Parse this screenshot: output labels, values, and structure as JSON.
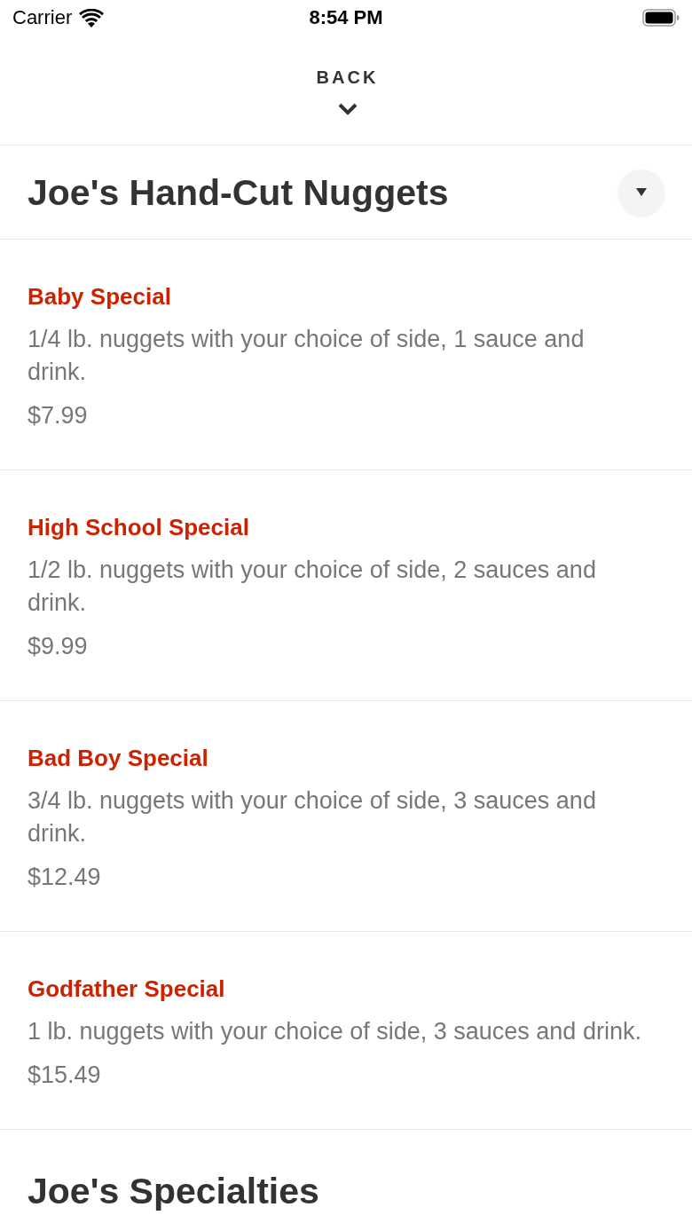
{
  "status_bar": {
    "carrier": "Carrier",
    "time": "8:54 PM"
  },
  "nav": {
    "back_label": "BACK"
  },
  "sections": [
    {
      "title": "Joe's Hand-Cut Nuggets",
      "dropdown": true,
      "items": [
        {
          "name": "Baby Special",
          "description": "1/4 lb. nuggets with your choice of side, 1 sauce and drink.",
          "price": "$7.99"
        },
        {
          "name": "High School Special",
          "description": "1/2 lb. nuggets with your choice of side, 2 sauces and drink.",
          "price": "$9.99"
        },
        {
          "name": "Bad Boy Special",
          "description": "3/4 lb. nuggets with your choice of side, 3 sauces and drink.",
          "price": "$12.49"
        },
        {
          "name": "Godfather Special",
          "description": "1 lb. nuggets with your choice of side, 3 sauces and drink.",
          "price": "$15.49"
        }
      ]
    },
    {
      "title": "Joe's Specialties",
      "dropdown": false
    }
  ]
}
